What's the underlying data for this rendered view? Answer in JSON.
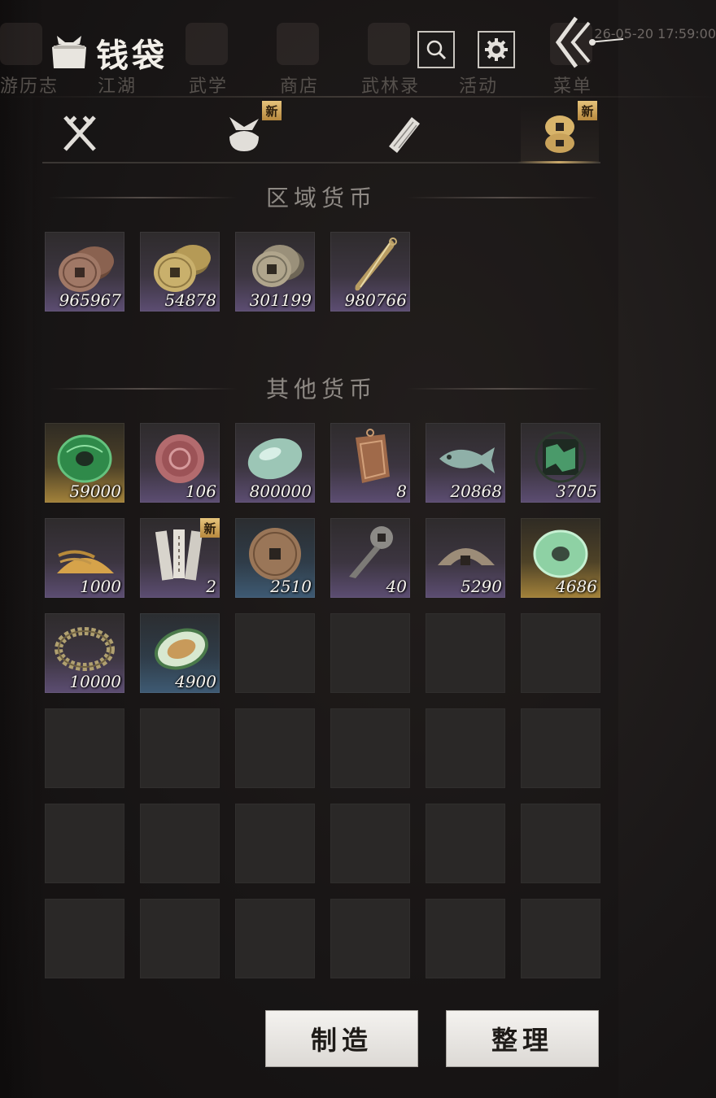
{
  "background": {
    "menu_items": [
      "游历志",
      "江湖",
      "武学",
      "商店",
      "武林录",
      "活动",
      "菜单"
    ],
    "time": "26-05-20 17:59:00"
  },
  "header": {
    "title": "钱袋",
    "search_icon": "search-icon",
    "settings_icon": "gear-icon",
    "back_icon": "double-chevron-left-icon"
  },
  "tabs": [
    {
      "icon": "crossed-swords-icon",
      "badge": ""
    },
    {
      "icon": "bundle-bag-icon",
      "badge": "新"
    },
    {
      "icon": "scroll-icon",
      "badge": ""
    },
    {
      "icon": "coins-icon",
      "badge": "新",
      "active": true
    }
  ],
  "sections": {
    "regional": {
      "title": "区域货币",
      "items": [
        {
          "icon": "copper-coins-icon",
          "quantity": "965967"
        },
        {
          "icon": "gold-coins-icon",
          "quantity": "54878"
        },
        {
          "icon": "bronze-coins-icon",
          "quantity": "301199"
        },
        {
          "icon": "blade-token-icon",
          "quantity": "980766"
        }
      ]
    },
    "other": {
      "title": "其他货币",
      "items": [
        {
          "icon": "green-jade-ring-icon",
          "quantity": "59000",
          "rarity": "gold"
        },
        {
          "icon": "red-seal-cake-icon",
          "quantity": "106"
        },
        {
          "icon": "jade-pebble-icon",
          "quantity": "800000"
        },
        {
          "icon": "bronze-tag-icon",
          "quantity": "8"
        },
        {
          "icon": "fish-icon",
          "quantity": "20868"
        },
        {
          "icon": "map-token-icon",
          "quantity": "3705"
        },
        {
          "icon": "grain-pile-icon",
          "quantity": "1000"
        },
        {
          "icon": "bamboo-slips-icon",
          "quantity": "2",
          "badge": "新"
        },
        {
          "icon": "large-coin-icon",
          "quantity": "2510",
          "rarity": "blue"
        },
        {
          "icon": "key-coin-icon",
          "quantity": "40"
        },
        {
          "icon": "half-coin-icon",
          "quantity": "5290"
        },
        {
          "icon": "pale-jade-ring-icon",
          "quantity": "4686",
          "rarity": "gold"
        },
        {
          "icon": "coin-string-icon",
          "quantity": "10000"
        },
        {
          "icon": "melon-icon",
          "quantity": "4900",
          "rarity": "blue"
        }
      ]
    }
  },
  "buttons": {
    "craft": "制造",
    "sort": "整理"
  }
}
